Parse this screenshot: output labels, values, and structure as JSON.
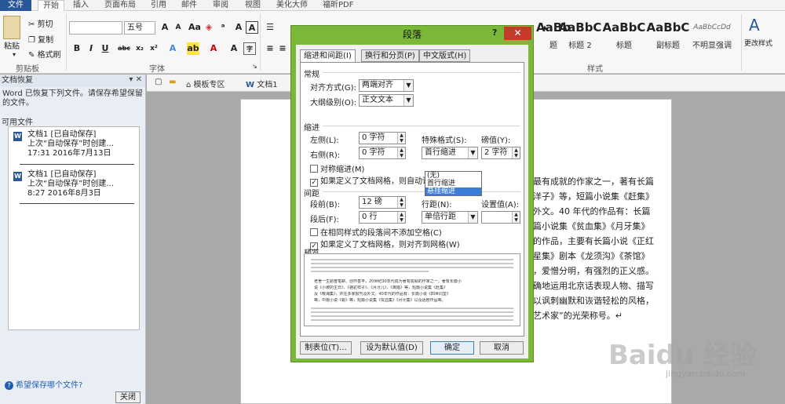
{
  "tabs": {
    "file": "文件",
    "items": [
      "开始",
      "插入",
      "页面布局",
      "引用",
      "邮件",
      "审阅",
      "视图",
      "美化大师",
      "福昕PDF"
    ]
  },
  "ribbon": {
    "clipboard": {
      "paste": "粘贴",
      "cut": "剪切",
      "copy": "复制",
      "format_painter": "格式刷",
      "label": "剪贴板"
    },
    "font": {
      "size": "五号",
      "label": "字体",
      "bold": "B",
      "italic": "I",
      "underline": "U",
      "strike": "abc",
      "sub": "x₂",
      "sup": "x²"
    },
    "styles": {
      "label": "样式",
      "items": [
        {
          "preview": "AaBb",
          "name": "题"
        },
        {
          "preview": "AaBbC",
          "name": "标题 2"
        },
        {
          "preview": "AaBbC",
          "name": "标题"
        },
        {
          "preview": "AaBbC",
          "name": "副标题"
        },
        {
          "preview": "AaBbCcDd",
          "name": "不明显强调"
        }
      ],
      "change_styles": "更改样式"
    }
  },
  "recovery": {
    "header": "文档恢复",
    "message": "Word 已恢复下列文件。请保存希望保留的文件。",
    "available": "可用文件",
    "files": [
      {
        "name": "文档1 [已自动保存]",
        "desc": "上次“自动保存”时创建...",
        "time": "17:31 2016年7月13日"
      },
      {
        "name": "文档1 [已自动保存]",
        "desc": "上次“自动保存”时创建...",
        "time": "8:27 2016年8月3日"
      }
    ],
    "help_link": "希望保存哪个文件?",
    "close": "关闭"
  },
  "doc_tabs": {
    "template": "模板专区",
    "doc": "文档1"
  },
  "document_lines": [
    "最有成就的作家之一，著有长篇",
    "洋子》等，短篇小说集《赶集》",
    "外文。40 年代的作品有：长篇",
    "篇小说集《贫血集》《月牙集》",
    "的作品，主要有长篇小说《正红",
    "星集》剧本《龙须沟》《茶馆》",
    "，爱憎分明，有强烈的正义感。",
    "确地运用北京话表现人物、描写",
    "以讽刺幽默和诙谐轻松的风格，",
    "艺术家”的光荣称号。↵"
  ],
  "watermark": "Baidu 经验",
  "watermark_url": "jingyan.baidu.com",
  "dialog": {
    "title": "段落",
    "help": "?",
    "close": "✕",
    "tabs": [
      "缩进和间距(I)",
      "换行和分页(P)",
      "中文版式(H)"
    ],
    "general": {
      "section": "常规",
      "alignment_label": "对齐方式(G):",
      "alignment": "两端对齐",
      "outline_label": "大纲级别(O):",
      "outline": "正文文本"
    },
    "indent": {
      "section": "缩进",
      "left_label": "左侧(L):",
      "left": "0 字符",
      "right_label": "右侧(R):",
      "right": "0 字符",
      "special_label": "特殊格式(S):",
      "special": "首行缩进",
      "value_label": "磅值(Y):",
      "value": "2 字符",
      "mirror": "对称缩进(M)",
      "grid": "如果定义了文档网格，则自动调整右缩进(D)"
    },
    "special_options": [
      "(无)",
      "首行缩进",
      "悬挂缩进"
    ],
    "spacing": {
      "section": "间距",
      "before_label": "段前(B):",
      "before": "12 磅",
      "after_label": "段后(F):",
      "after": "0 行",
      "line_label": "行距(N):",
      "line": "单倍行距",
      "at_label": "设置值(A):",
      "at": "",
      "no_space": "在相同样式的段落间不添加空格(C)",
      "snap": "如果定义了文档网格，则对齐到网格(W)"
    },
    "preview": {
      "section": "预览",
      "lines": [
        "老舍一生勤奋笔耕、创作甚丰，20世纪30年代成为著有成就的作家之一，著有长篇小",
        "说《小坡的生日》、《骆驼祥子》、《月牙儿》、《离婚》等，短篇小说集《赶集》",
        "及《樱海集》，并在多家报刊及外文。40年代的作品有：长篇小说《四世同堂》",
        "等，中篇小说《蜕》等，短篇小说集《贫血集》《月牙集》以及话剧作品等。"
      ]
    },
    "buttons": {
      "tabs": "制表位(T)...",
      "default": "设为默认值(D)",
      "ok": "确定",
      "cancel": "取消"
    }
  }
}
